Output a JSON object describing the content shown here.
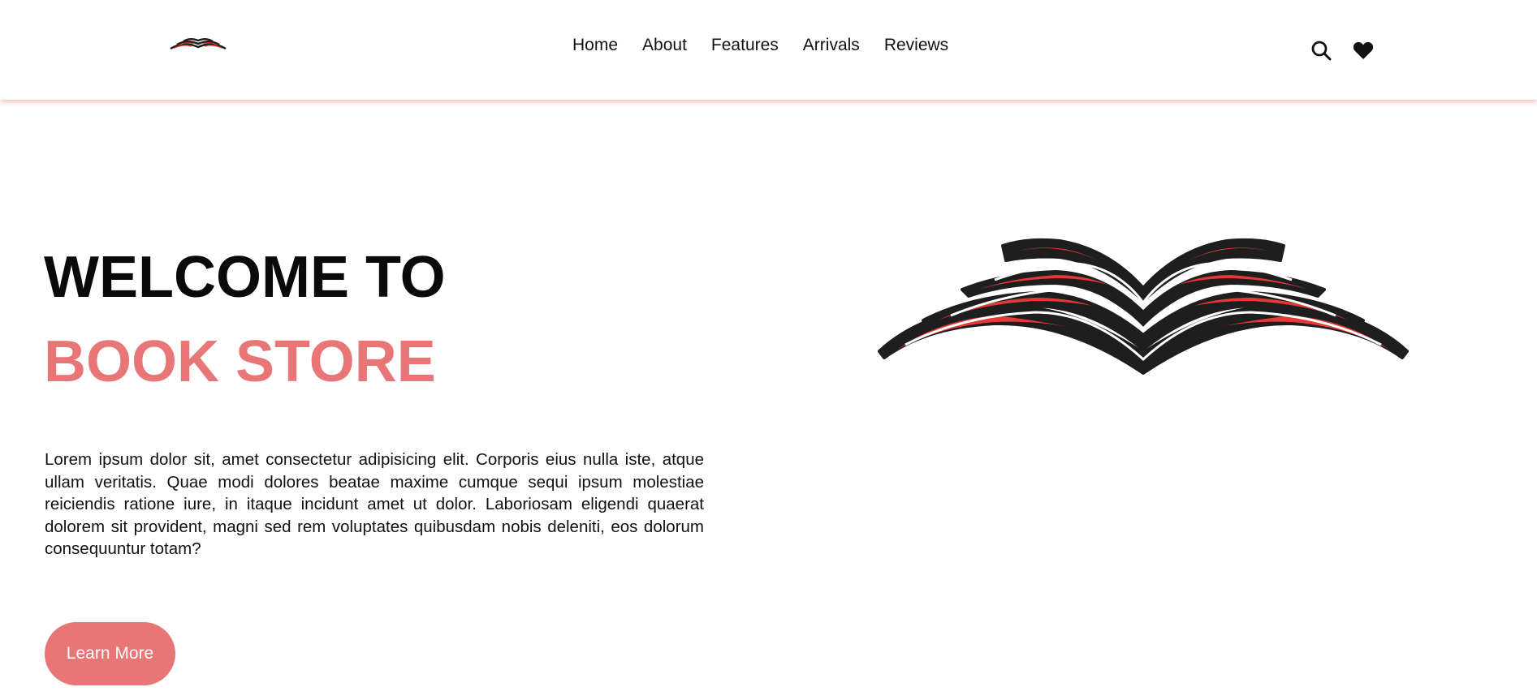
{
  "header": {
    "logo_icon": "open-book-logo",
    "nav": [
      {
        "label": "Home"
      },
      {
        "label": "About"
      },
      {
        "label": "Features"
      },
      {
        "label": "Arrivals"
      },
      {
        "label": "Reviews"
      }
    ],
    "icons": [
      "search-icon",
      "heart-icon"
    ]
  },
  "hero": {
    "title_line1": "WELCOME TO",
    "title_line2": "BOOK STORE",
    "description": "Lorem ipsum dolor sit, amet consectetur adipisicing elit. Corporis eius nulla iste, atque ullam veritatis. Quae modi dolores beatae maxime cumque sequi ipsum molestiae reiciendis ratione iure, in itaque incidunt amet ut dolor. Laboriosam eligendi quaerat dolorem sit provident, magni sed rem voluptates quibusdam nobis deleniti, eos dolorum consequuntur totam?",
    "button_label": "Learn More",
    "image_icon": "open-book-illustration"
  },
  "colors": {
    "accent": "#e87676",
    "text": "#111111",
    "book_red": "#e53935",
    "book_dark": "#1e1e1e"
  }
}
